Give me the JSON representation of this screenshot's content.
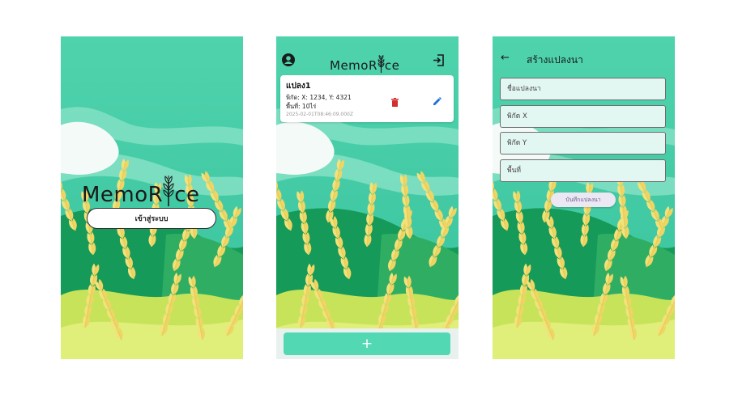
{
  "app": {
    "name_part1": "MemoR",
    "name_part2": "ce"
  },
  "login": {
    "button_label": "เข้าสู่ระบบ"
  },
  "home": {
    "plots": [
      {
        "name": "แปลง1",
        "coords": "พิกัด: X: 1234, Y: 4321",
        "area": "พื้นที่: 10ไร่",
        "timestamp": "2025-02-01T08:46:09.000Z"
      }
    ],
    "add_label": "+"
  },
  "create": {
    "title": "สร้างแปลงนา",
    "fields": {
      "name_placeholder": "ชื่อแปลงนา",
      "x_placeholder": "พิกัด X",
      "y_placeholder": "พิกัด Y",
      "area_placeholder": "พื้นที่"
    },
    "save_label": "บันทึกแปลงนา"
  },
  "colors": {
    "sky": "#4fd3ad",
    "hill_dark": "#159a5a",
    "hill_mid": "#2fae63",
    "wheat": "#f3e27c",
    "accent_btn": "#52d9b4"
  }
}
